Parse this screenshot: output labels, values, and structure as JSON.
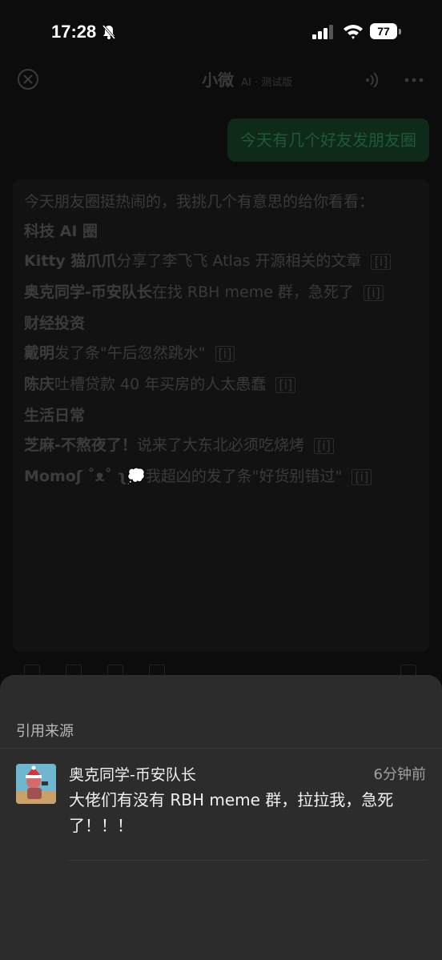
{
  "status_bar": {
    "time": "17:28",
    "battery": "77"
  },
  "header": {
    "title": "小微",
    "subtitle": "AI · 测试版"
  },
  "user_message": "今天有几个好友发朋友圈",
  "ai_reply": {
    "intro": "今天朋友圈挺热闹的，我挑几个有意思的给你看看：",
    "citation_mark": "[i]",
    "sections": [
      {
        "heading": "科技 AI 圈",
        "items": [
          {
            "name": "Kitty 猫爪爪",
            "text": "分享了李飞飞 Atlas 开源相关的文章"
          },
          {
            "name": "奥克同学-币安队长",
            "text": "在找 RBH meme 群，急死了"
          }
        ]
      },
      {
        "heading": "财经投资",
        "items": [
          {
            "name": "戴明",
            "text": "发了条\"午后忽然跳水\""
          },
          {
            "name": "陈庆",
            "text": "吐槽贷款 40 年买房的人太愚蠢"
          }
        ]
      },
      {
        "heading": "生活日常",
        "items": [
          {
            "name": "芝麻-不熬夜了！",
            "text": "说来了大东北必须吃烧烤"
          },
          {
            "name": "Momoʃ ˚ᴥ˚ ʅ💭",
            "text": "我超凶的发了条\"好货别错过\""
          }
        ]
      }
    ]
  },
  "sheet": {
    "title": "引用来源",
    "sources": [
      {
        "name": "奥克同学-币安队长",
        "time": "6分钟前",
        "text": "大佬们有没有 RBH meme 群，拉拉我，急死了！！！"
      }
    ]
  },
  "colors": {
    "background": "#0c0c0c",
    "sheet": "#2c2c2c",
    "user_bubble": "#0f2a18"
  }
}
